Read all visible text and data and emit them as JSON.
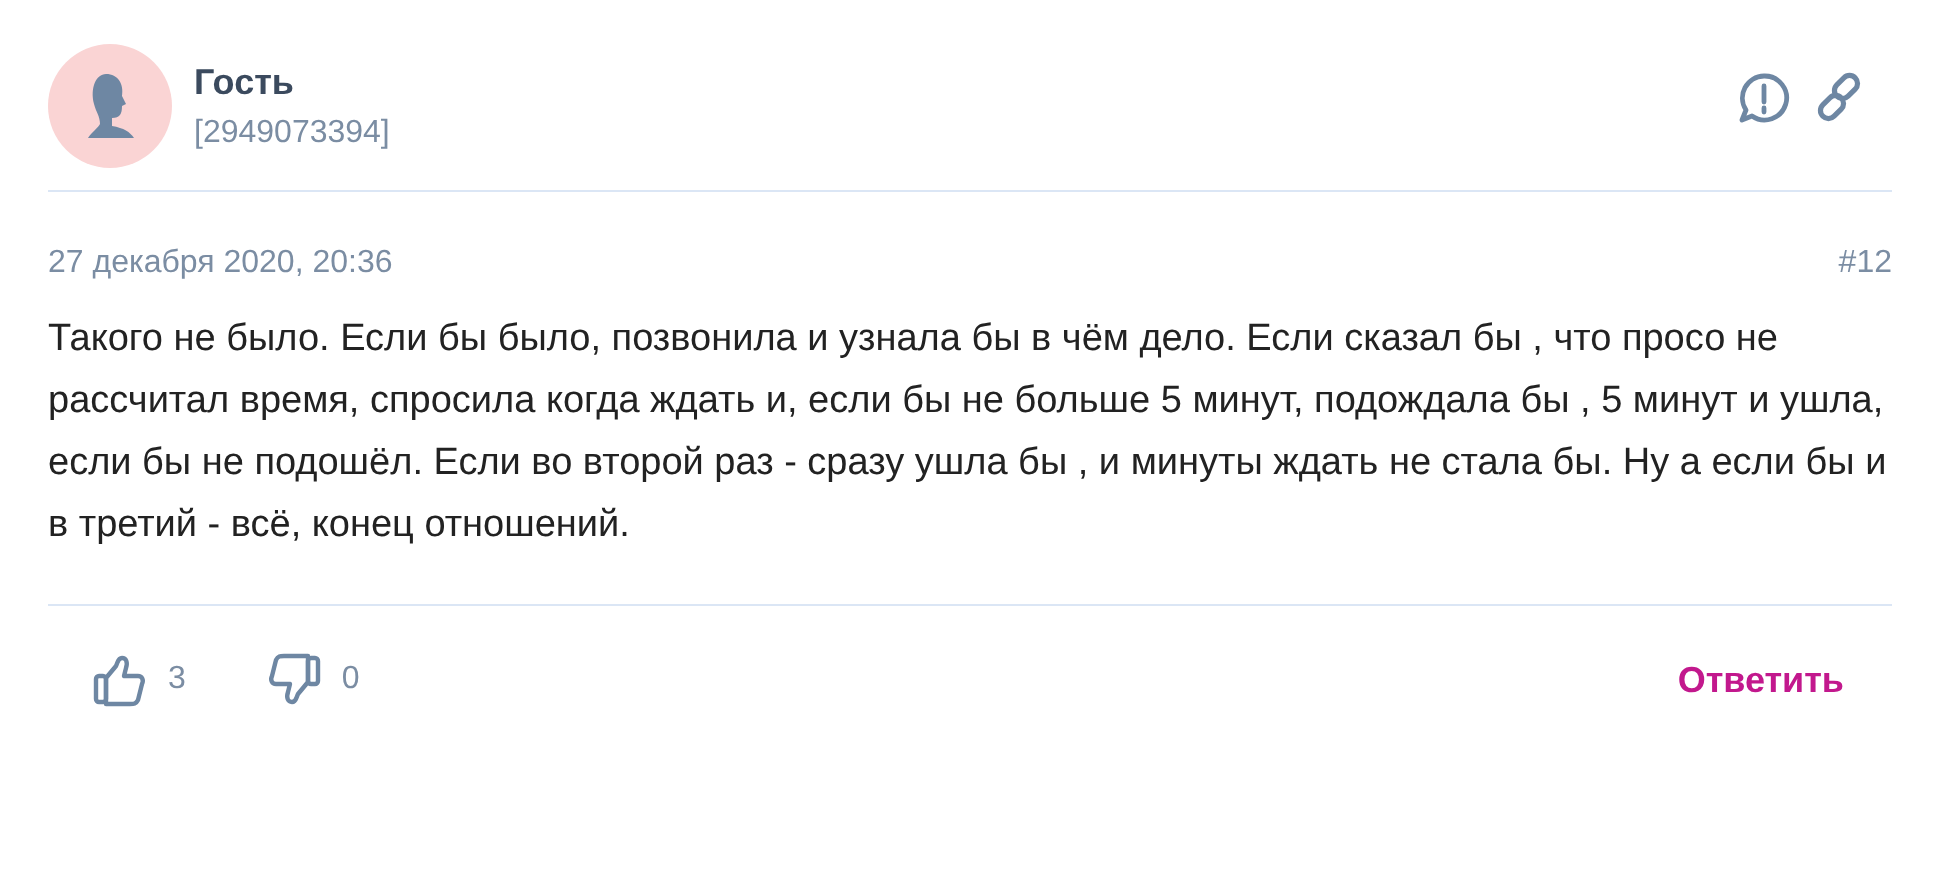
{
  "author": {
    "name": "Гость",
    "id": "[2949073394]"
  },
  "date": "27 декабря 2020, 20:36",
  "number": "#12",
  "text": "Такого не было. Если бы было, позвонила и узнала бы в чём дело. Если сказал бы , что просо не рассчитал время, спросила когда ждать и, если бы не больше 5 минут, подождала бы , 5 минут и ушла, если бы не подошёл. Если во второй раз - сразу ушла бы , и минуты ждать не стала бы. Ну а если бы и в третий - всё, конец отношений.",
  "likes": "3",
  "dislikes": "0",
  "reply": "Ответить"
}
